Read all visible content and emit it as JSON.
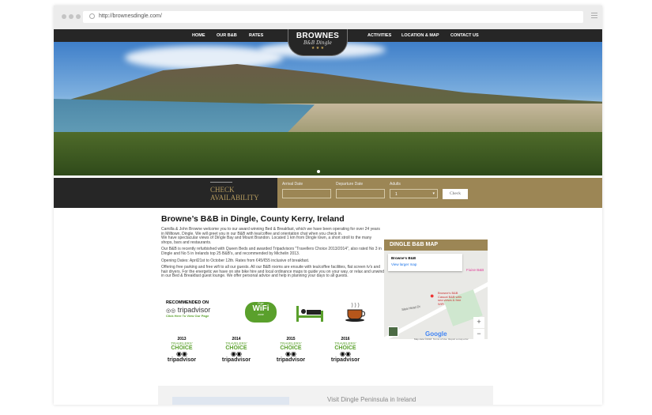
{
  "browser": {
    "url": "http://brownesdingle.com/"
  },
  "nav": {
    "left": [
      "HOME",
      "OUR B&B",
      "RATES"
    ],
    "right": [
      "ACTIVITIES",
      "LOCATION & MAP",
      "CONTACT US"
    ]
  },
  "logo": {
    "title": "BROWNES",
    "subtitle": "B&B Dingle",
    "stars": "★ ★ ★"
  },
  "availability": {
    "heading_1": "CHECK",
    "heading_2": "AVAILABILITY",
    "arrival_label": "Arrival Date",
    "arrival_value": "",
    "departure_label": "Departure Date",
    "departure_value": "",
    "adults_label": "Adults",
    "adults_value": "1",
    "check_label": "Check"
  },
  "content": {
    "title": "Browne’s B&B in Dingle, County Kerry, Ireland",
    "paragraphs": [
      "Camilla & John Browne welcome you to our award winning Bed & Breakfast, which we have been operating for over 24 years in Milltown, Dingle. We will greet you in our B&B with tea/coffee and orientation chat when you check in.",
      "We have spectacular views of Dingle Bay and Mount Brandon. Located 1 km from Dingle town, a short stroll to the many shops, bars and restaurants.",
      "Our B&B is recently refurbished with Queen Beds and awarded Tripadvisors \"Travellers Choice 2013/2014\", also rated No 3 in Dingle and No 5 in Irelands top 25 B&B's, and recommended by Michelin 2013.",
      "Opening Dates: April21st to October 12th. Rates from €45/€55 inclusive of breakfast.",
      "Offering free parking and free wifi to all our guests. All our B&B rooms are ensuite with tea/coffee facilities, flat screen tv's and hair dryers. For the energetic we have on site bike hire and local ordinance maps to guide you on your way, or relax and unwind in our Bed & Breakfast guest lounge. We offer personal advice and help in planning your days to all guests."
    ]
  },
  "tripadvisor": {
    "recommended": "RECOMMENDED ON",
    "brand": "tripadvisor",
    "link": "Click Here To View Our Page"
  },
  "wifi": {
    "free": "Free",
    "label": "WiFi",
    "zone": "zone"
  },
  "badges": [
    {
      "year": "2013"
    },
    {
      "year": "2014"
    },
    {
      "year": "2015"
    },
    {
      "year": "2016"
    }
  ],
  "badge_text": {
    "travelers": "TRAVELERS'",
    "choice": "CHOICE",
    "brand": "tripadvisor"
  },
  "map": {
    "heading": "DINGLE B&B MAP",
    "place": "Browne's B&B",
    "larger": "View larger map",
    "pin_title": "Browne's B&B",
    "pin_desc": "Casual B&B with sea views & free WiFi",
    "poi": "Fiuise B&B",
    "road": "Slea Head Dr",
    "google": "Google",
    "data": "Map data ©2018",
    "terms": "Terms of Use",
    "report": "Report a map error",
    "zoom_in": "+",
    "zoom_out": "−"
  },
  "footer": {
    "text": "Visit Dingle Peninsula in Ireland"
  }
}
